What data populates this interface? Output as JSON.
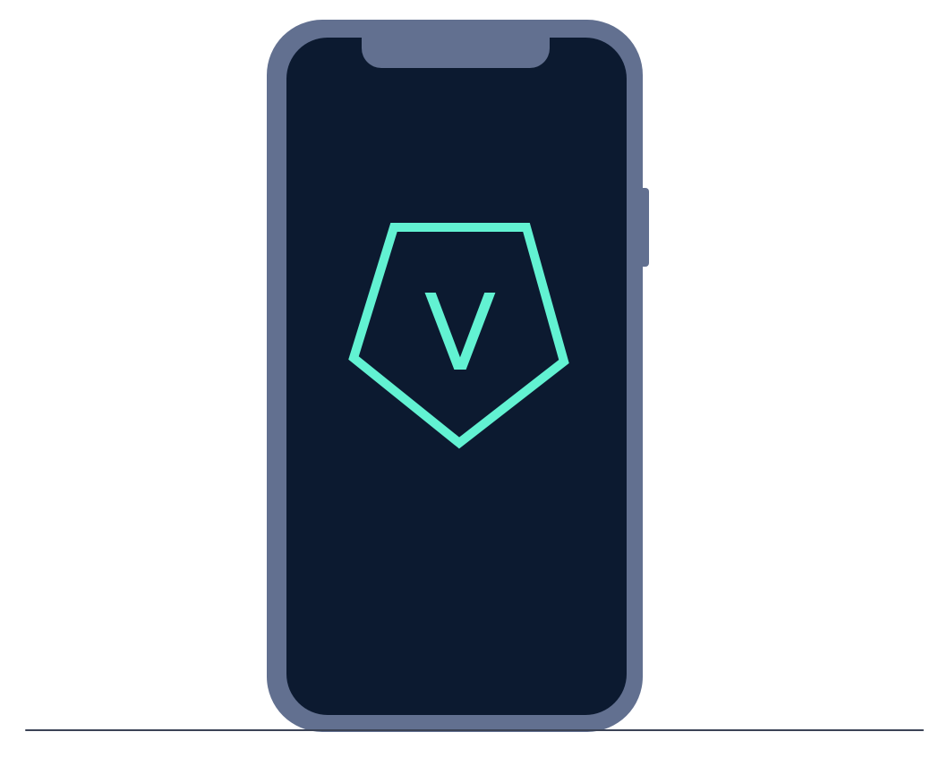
{
  "logo": {
    "letter": "V",
    "shape": "pentagon-shield",
    "color": "#62f2d2"
  },
  "device": {
    "frame_color": "#627090",
    "screen_color": "#0c1a30",
    "ground_line_color": "#3b4356"
  }
}
